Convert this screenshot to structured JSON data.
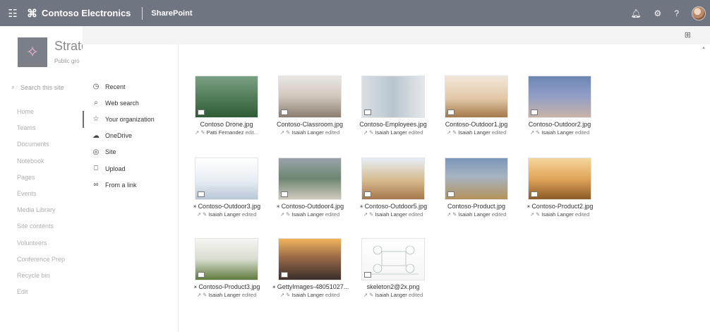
{
  "suite": {
    "waffle_icon": "waffle-icon",
    "brand": "Contoso Electronics",
    "app": "SharePoint"
  },
  "site": {
    "title": "Strate",
    "subtitle": "Public gro",
    "search_placeholder": "Search this site",
    "nav": [
      "Home",
      "Teams",
      "Documents",
      "Notebook",
      "Pages",
      "Events",
      "Media Library",
      "Site contents",
      "Volunteers",
      "Conference Prep",
      "Recycle bin",
      "Edit"
    ]
  },
  "picker": {
    "nav": [
      {
        "label": "Recent",
        "icon": "clock-icon",
        "glyph": "◷"
      },
      {
        "label": "Web search",
        "icon": "search-icon",
        "glyph": "⌕"
      },
      {
        "label": "Your organization",
        "icon": "star-icon",
        "glyph": "☆"
      },
      {
        "label": "OneDrive",
        "icon": "cloud-icon",
        "glyph": "☁"
      },
      {
        "label": "Site",
        "icon": "globe-icon",
        "glyph": "◎"
      },
      {
        "label": "Upload",
        "icon": "upload-icon",
        "glyph": "⎕"
      },
      {
        "label": "From a link",
        "icon": "link-icon",
        "glyph": "∞"
      }
    ],
    "selected": "Your organization",
    "files": [
      {
        "name": "Contoso Drone.jpg",
        "editor": "Patti Fernandez",
        "action": "edit...",
        "new": false
      },
      {
        "name": "Contoso-Classroom.jpg",
        "editor": "Isaiah Langer",
        "action": "edited",
        "new": false
      },
      {
        "name": "Contoso-Employees.jpg",
        "editor": "Isaiah Langer",
        "action": "edited",
        "new": false
      },
      {
        "name": "Contoso-Outdoor1.jpg",
        "editor": "Isaiah Langer",
        "action": "edited",
        "new": false
      },
      {
        "name": "Contoso-Outdoor2.jpg",
        "editor": "Isaiah Langer",
        "action": "edited",
        "new": false
      },
      {
        "name": "Contoso-Outdoor3.jpg",
        "editor": "Isaiah Langer",
        "action": "edited",
        "new": true
      },
      {
        "name": "Contoso-Outdoor4.jpg",
        "editor": "Isaiah Langer",
        "action": "edited",
        "new": true
      },
      {
        "name": "Contoso-Outdoor5.jpg",
        "editor": "Isaiah Langer",
        "action": "edited",
        "new": true
      },
      {
        "name": "Contoso-Product.jpg",
        "editor": "Isaiah Langer",
        "action": "edited",
        "new": false
      },
      {
        "name": "Contoso-Product2.jpg",
        "editor": "Isaiah Langer",
        "action": "edited",
        "new": true
      },
      {
        "name": "Contoso-Product3.jpg",
        "editor": "Isaiah Langer",
        "action": "edited",
        "new": true
      },
      {
        "name": "GettyImages-48051027...",
        "editor": "Isaiah Langer",
        "action": "edited",
        "new": true
      },
      {
        "name": "skeleton2@2x.png",
        "editor": "Isaiah Langer",
        "action": "edited",
        "new": false
      }
    ]
  }
}
